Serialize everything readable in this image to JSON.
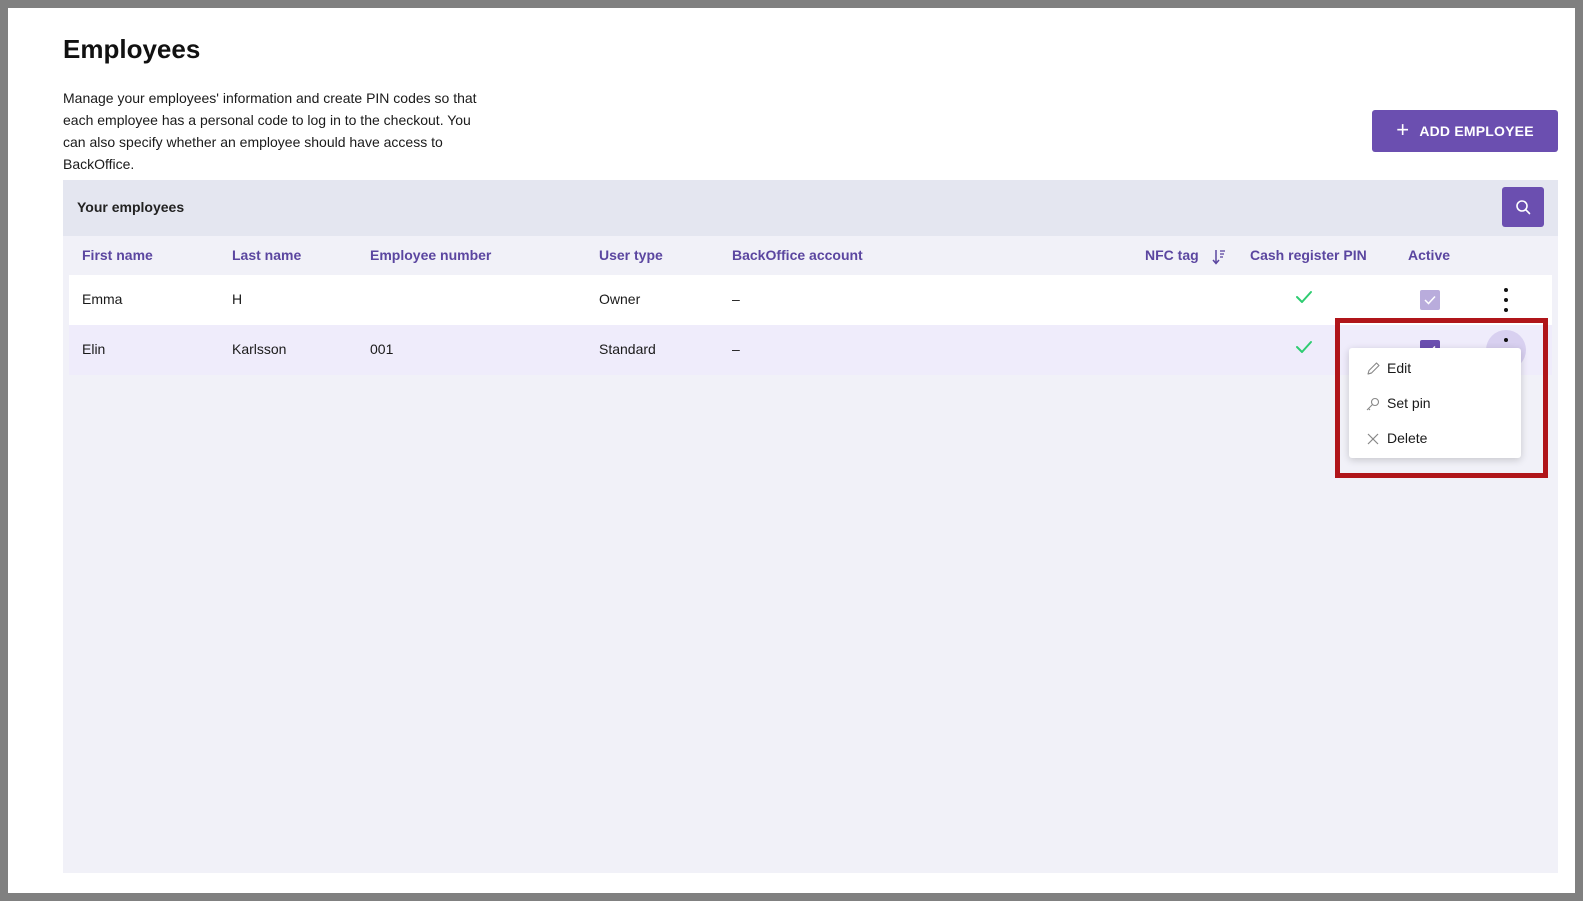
{
  "page": {
    "title": "Employees",
    "description": "Manage your employees' information and create PIN codes so that each employee has a personal code to log in to the checkout. You can also specify whether an employee should have access to BackOffice.",
    "add_button_label": "ADD EMPLOYEE"
  },
  "panel": {
    "title": "Your employees",
    "columns": {
      "first_name": "First name",
      "last_name": "Last name",
      "employee_number": "Employee number",
      "user_type": "User type",
      "backoffice_account": "BackOffice account",
      "nfc_tag": "NFC tag",
      "cash_register_pin": "Cash register PIN",
      "active": "Active"
    },
    "rows": [
      {
        "first_name": "Emma",
        "last_name": "H",
        "employee_number": "",
        "user_type": "Owner",
        "backoffice_account": "–",
        "pin_set": true,
        "active": true
      },
      {
        "first_name": "Elin",
        "last_name": "Karlsson",
        "employee_number": "001",
        "user_type": "Standard",
        "backoffice_account": "–",
        "pin_set": true,
        "active": true
      }
    ]
  },
  "context_menu": {
    "items": [
      {
        "label": "Edit",
        "icon": "pencil-icon"
      },
      {
        "label": "Set pin",
        "icon": "key-icon"
      },
      {
        "label": "Delete",
        "icon": "close-icon"
      }
    ]
  },
  "colors": {
    "accent": "#6b4fb0",
    "check": "#2ecc71",
    "highlight_border": "#b0151a"
  }
}
